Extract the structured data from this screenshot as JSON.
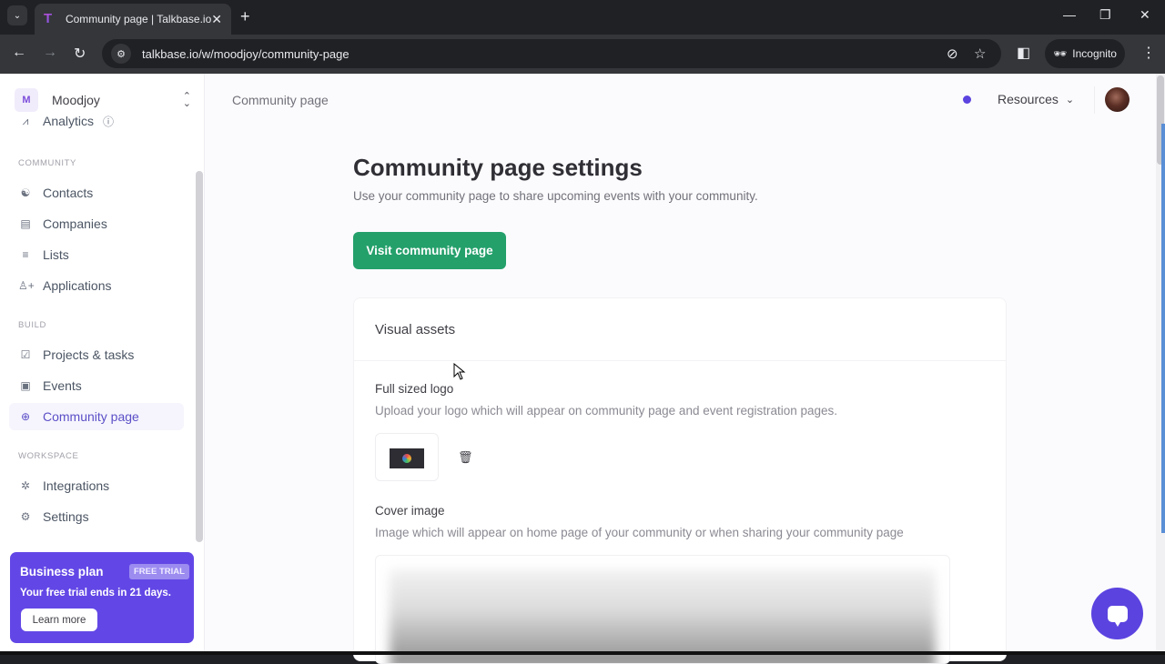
{
  "browser": {
    "tab_title": "Community page | Talkbase.io",
    "tab_favicon": "T",
    "url": "talkbase.io/w/moodjoy/community-page",
    "incognito_label": "Incognito",
    "icons": {
      "tab_list": "⌄",
      "close": "✕",
      "new_tab": "+",
      "minimize": "—",
      "restore": "❐",
      "window_close": "✕",
      "back": "←",
      "forward": "→",
      "reload": "↻",
      "site_info": "⚙",
      "eye_off": "⊘",
      "star": "☆",
      "side_panel": "◧",
      "incognito": "🕶",
      "menu": "⋮"
    }
  },
  "sidebar": {
    "workspace": {
      "initial": "M",
      "name": "Moodjoy",
      "chevrons": "⌃⌄"
    },
    "top_item": {
      "label": "Analytics",
      "icon": "📈",
      "info_icon": "ⓘ"
    },
    "sections": [
      {
        "label": "COMMUNITY",
        "items": [
          {
            "label": "Contacts",
            "icon": "👥"
          },
          {
            "label": "Companies",
            "icon": "▤"
          },
          {
            "label": "Lists",
            "icon": "≡"
          },
          {
            "label": "Applications",
            "icon": "👤+"
          }
        ]
      },
      {
        "label": "BUILD",
        "items": [
          {
            "label": "Projects & tasks",
            "icon": "☑"
          },
          {
            "label": "Events",
            "icon": "📅"
          },
          {
            "label": "Community page",
            "icon": "⊕",
            "active": true
          }
        ]
      },
      {
        "label": "WORKSPACE",
        "items": [
          {
            "label": "Integrations",
            "icon": "✲"
          },
          {
            "label": "Settings",
            "icon": "⚙"
          }
        ]
      }
    ],
    "plan": {
      "title": "Business plan",
      "badge": "FREE TRIAL",
      "description": "Your free trial ends in 21 days.",
      "button": "Learn more"
    }
  },
  "header": {
    "breadcrumb": "Community page",
    "resources_label": "Resources",
    "resources_chevron": "⌄",
    "status_color": "#5b43e0"
  },
  "main": {
    "title": "Community page settings",
    "subtitle": "Use your community page to share upcoming events with your community.",
    "visit_button": "Visit community page",
    "card": {
      "title": "Visual assets",
      "logo": {
        "label": "Full sized logo",
        "description": "Upload your logo which will appear on community page and event registration pages.",
        "delete_icon": "🗑"
      },
      "cover": {
        "label": "Cover image",
        "description": "Image which will appear on home page of your community or when sharing your community page"
      }
    }
  },
  "colors": {
    "accent": "#5b43e0",
    "primary_button": "#24a06b",
    "plan_card": "#6347e6"
  }
}
